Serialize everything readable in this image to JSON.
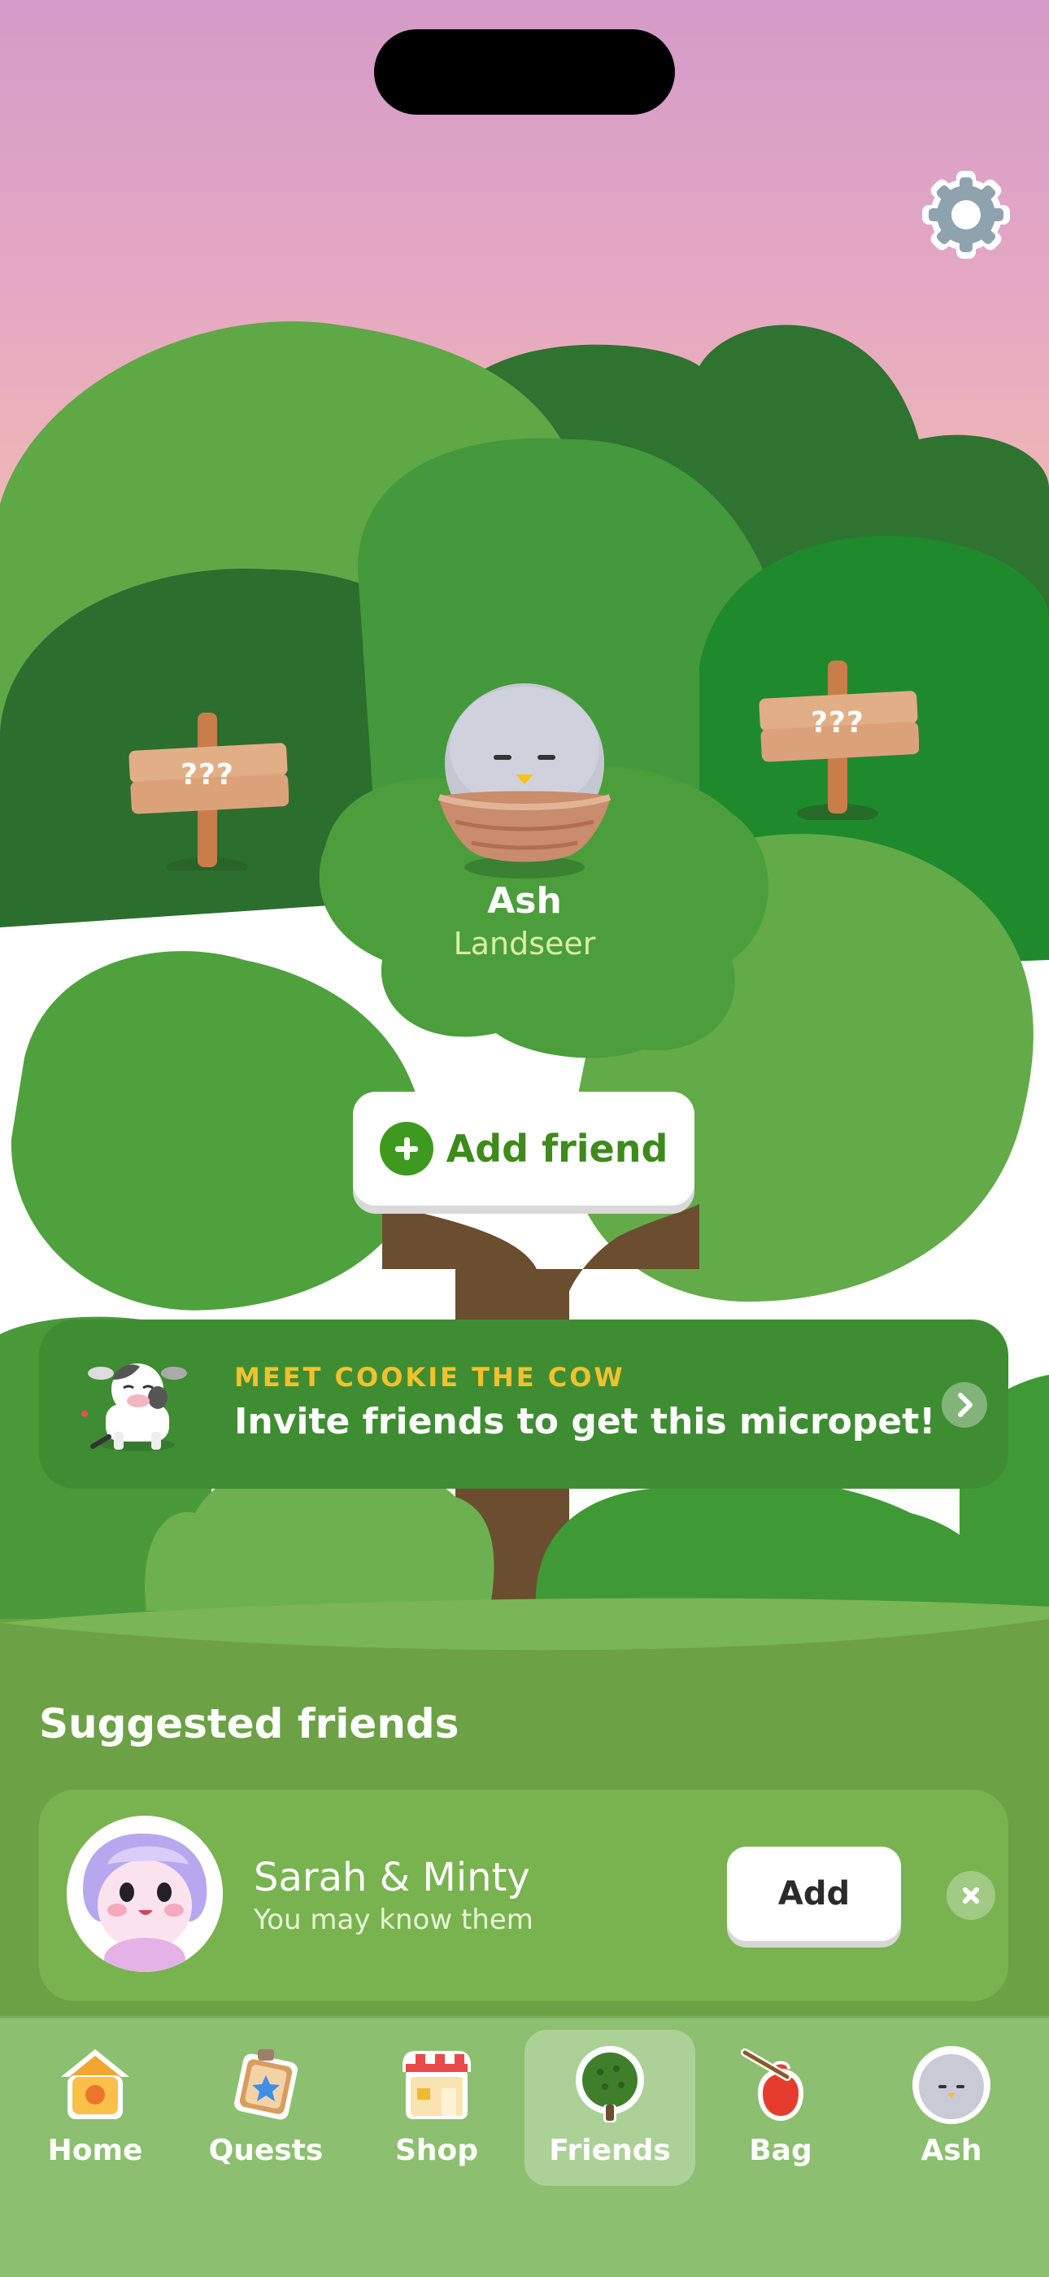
{
  "colors": {
    "sky_top": "#d49bc8",
    "sky_bottom": "#f0b9b4",
    "grass": "#6ca145",
    "accent_green": "#3e9a1f",
    "promo_kicker": "#f2c12e"
  },
  "settings": {
    "icon": "gear-icon"
  },
  "signs": [
    {
      "label": "???"
    },
    {
      "label": "???"
    }
  ],
  "pet": {
    "name": "Ash",
    "breed": "Landseer"
  },
  "add_friend": {
    "label": "Add friend",
    "icon": "plus-circle-icon"
  },
  "promo": {
    "kicker": "MEET COOKIE THE COW",
    "text": "Invite friends to get this micropet!",
    "icon": "chevron-right-icon"
  },
  "suggested": {
    "title": "Suggested friends",
    "friends": [
      {
        "name": "Sarah & Minty",
        "subtitle": "You may know them",
        "add_label": "Add"
      }
    ]
  },
  "tabs": [
    {
      "label": "Home",
      "icon": "birdhouse-icon",
      "active": false
    },
    {
      "label": "Quests",
      "icon": "quest-map-icon",
      "active": false
    },
    {
      "label": "Shop",
      "icon": "shop-icon",
      "active": false
    },
    {
      "label": "Friends",
      "icon": "tree-icon",
      "active": true
    },
    {
      "label": "Bag",
      "icon": "bag-icon",
      "active": false
    },
    {
      "label": "Ash",
      "icon": "pet-avatar-icon",
      "active": false
    }
  ]
}
